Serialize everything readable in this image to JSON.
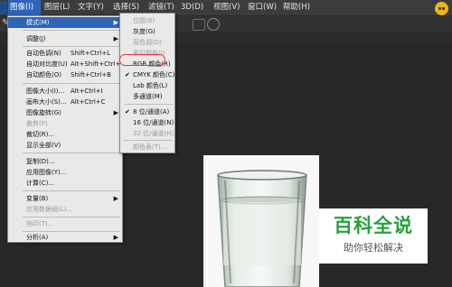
{
  "menubar": {
    "items": [
      {
        "label": "图像(I)"
      },
      {
        "label": "图层(L)"
      },
      {
        "label": "文字(Y)"
      },
      {
        "label": "选择(S)"
      },
      {
        "label": "滤镜(T)"
      },
      {
        "label": "3D(D)"
      },
      {
        "label": "视图(V)"
      },
      {
        "label": "窗口(W)"
      },
      {
        "label": "帮助(H)"
      }
    ]
  },
  "image_menu": {
    "items": [
      {
        "label": "模式(M)",
        "shortcut": ""
      },
      {
        "label": "调整(J)",
        "shortcut": ""
      },
      {
        "label": "自动色调(N)",
        "shortcut": "Shift+Ctrl+L"
      },
      {
        "label": "自动对比度(U)",
        "shortcut": "Alt+Shift+Ctrl+L"
      },
      {
        "label": "自动颜色(O)",
        "shortcut": "Shift+Ctrl+B"
      },
      {
        "label": "图像大小(I)...",
        "shortcut": "Alt+Ctrl+I"
      },
      {
        "label": "画布大小(S)...",
        "shortcut": "Alt+Ctrl+C"
      },
      {
        "label": "图像旋转(G)",
        "shortcut": ""
      },
      {
        "label": "裁剪(P)",
        "shortcut": ""
      },
      {
        "label": "裁切(R)...",
        "shortcut": ""
      },
      {
        "label": "显示全部(V)",
        "shortcut": ""
      },
      {
        "label": "复制(D)...",
        "shortcut": ""
      },
      {
        "label": "应用图像(Y)...",
        "shortcut": ""
      },
      {
        "label": "计算(C)...",
        "shortcut": ""
      },
      {
        "label": "变量(B)",
        "shortcut": ""
      },
      {
        "label": "应用数据组(L)...",
        "shortcut": ""
      },
      {
        "label": "陷印(T)...",
        "shortcut": ""
      },
      {
        "label": "分析(A)",
        "shortcut": ""
      }
    ]
  },
  "mode_submenu": {
    "items": [
      {
        "label": "位图(B)"
      },
      {
        "label": "灰度(G)"
      },
      {
        "label": "双色调(D)"
      },
      {
        "label": "索引颜色(I)"
      },
      {
        "label": "RGB 颜色(R)"
      },
      {
        "label": "CMYK 颜色(C)"
      },
      {
        "label": "Lab 颜色(L)"
      },
      {
        "label": "多通道(M)"
      },
      {
        "label": "8 位/通道(A)"
      },
      {
        "label": "16 位/通道(N)"
      },
      {
        "label": "32 位/通道(H)"
      },
      {
        "label": "颜色表(T)..."
      }
    ]
  },
  "watermark": {
    "title": "百科全说",
    "subtitle": "助你轻松解决"
  },
  "colors": {
    "highlight": "#2f63b8",
    "annotation": "#e23b3b",
    "watermark_green": "#27a23a"
  }
}
